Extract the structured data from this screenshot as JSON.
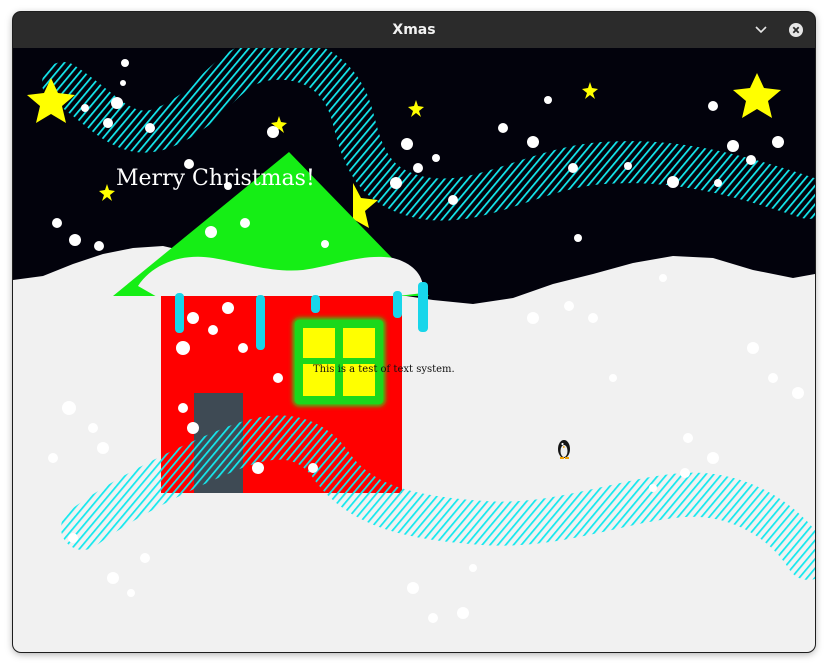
{
  "window": {
    "title": "Xmas",
    "buttons": {
      "minimize_icon": "chevron-down-icon",
      "close_icon": "close-icon"
    }
  },
  "scene": {
    "greeting": "Merry Christmas!",
    "test_text": "This is a test of text system.",
    "colors": {
      "sky": "#02020c",
      "snow": "#f1f1f1",
      "aurora": "#14e8ee",
      "roof": "#15ee15",
      "house": "#ff0000",
      "door": "#3e4a54",
      "window_frame": "#18e618",
      "window_glass": "#ffff00",
      "star": "#ffff00",
      "icicle": "#18d6ea"
    },
    "sprites": {
      "player_icon": "penguin-icon",
      "star_icon": "star-icon"
    }
  }
}
